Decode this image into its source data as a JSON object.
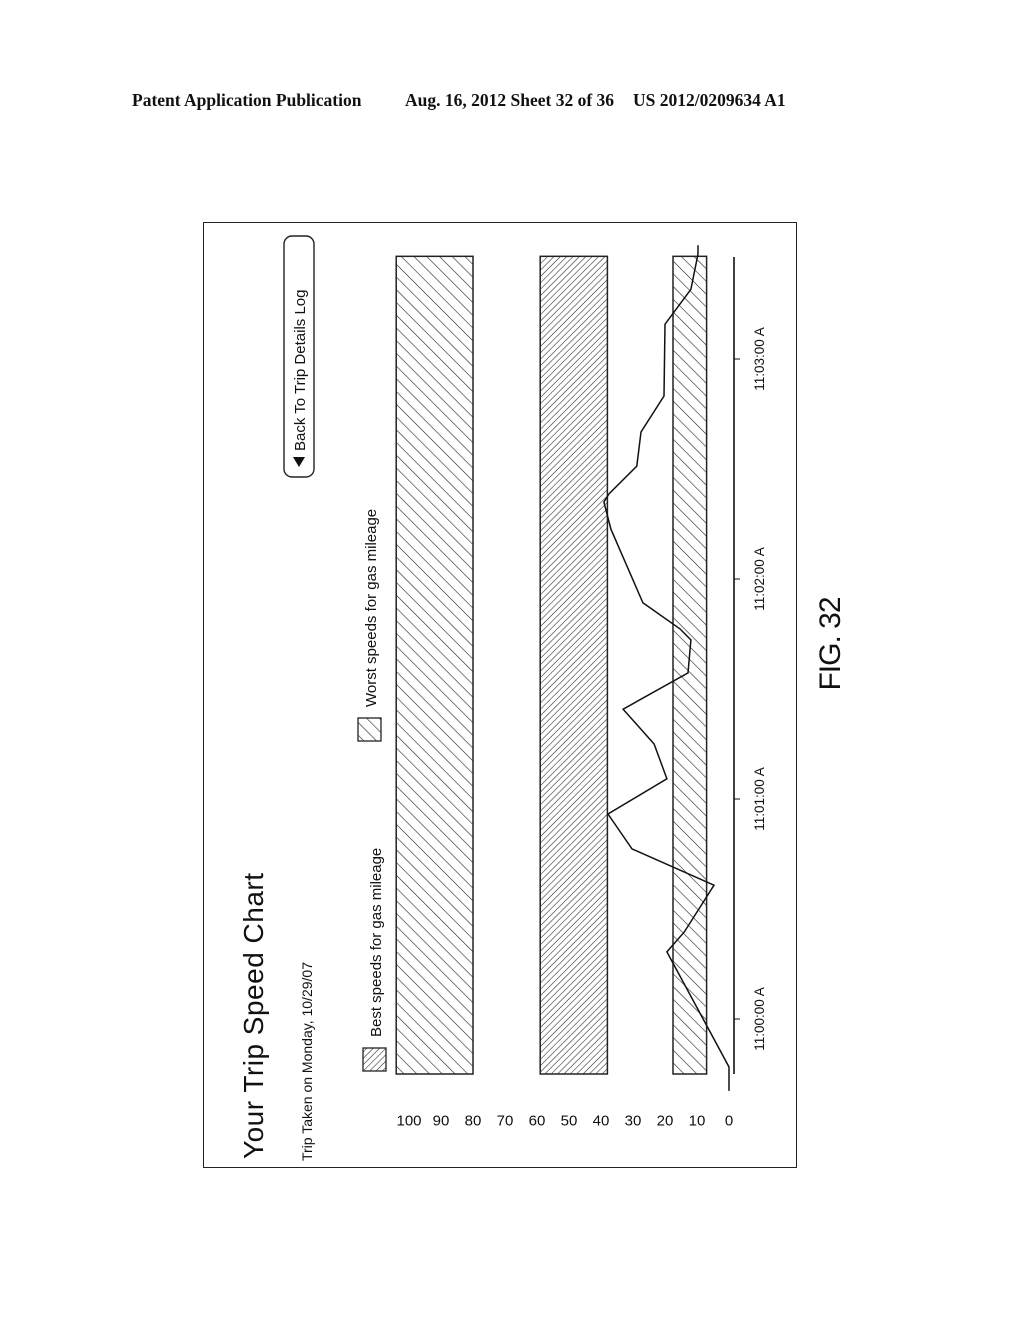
{
  "header": {
    "left": "Patent Application Publication",
    "middle": "Aug. 16, 2012  Sheet 32 of 36",
    "right": "US 2012/0209634 A1"
  },
  "figure_label": "FIG. 32",
  "screen": {
    "title": "Your Trip Speed Chart",
    "subtitle": "Trip Taken on Monday, 10/29/07",
    "back_button": {
      "label": "Back To Trip Details Log",
      "icon": "triangle-left-icon"
    }
  },
  "chart_data": {
    "type": "line",
    "title": "Your Trip Speed Chart",
    "subtitle": "Trip Taken on Monday, 10/29/07",
    "xlabel": "",
    "ylabel": "",
    "orientation": "rotated -90 degrees on page",
    "ylim": [
      0,
      100
    ],
    "yticks": [
      "100",
      "90",
      "80",
      "70",
      "60",
      "50",
      "40",
      "30",
      "20",
      "10",
      "0"
    ],
    "ytick_values": [
      100,
      90,
      80,
      70,
      60,
      50,
      40,
      30,
      20,
      10,
      0
    ],
    "xticks": [
      "11:00:00 A",
      "11:01:00 A",
      "11:02:00 A",
      "11:03:00 A"
    ],
    "xtick_seconds": [
      0,
      60,
      120,
      180
    ],
    "xlim_seconds": [
      -20,
      210
    ],
    "grid": false,
    "legend": [
      {
        "name": "Best speeds for gas mileage",
        "pattern": "dense-hatch"
      },
      {
        "name": "Worst speeds for gas mileage",
        "pattern": "sparse-hatch"
      }
    ],
    "legend_position": "top",
    "bands": [
      {
        "name": "Worst speeds for gas mileage",
        "low": 80,
        "high": 104,
        "pattern": "sparse-hatch"
      },
      {
        "name": "Best speeds for gas mileage",
        "low": 38,
        "high": 59,
        "pattern": "dense-hatch"
      },
      {
        "name": "Worst speeds for gas mileage",
        "low": 7,
        "high": 17.5,
        "pattern": "sparse-hatch"
      }
    ],
    "band_time_range_seconds": [
      -15,
      208
    ],
    "series": [
      {
        "name": "Trip speed",
        "t_seconds": [
          -19.6,
          -13.1,
          -8.2,
          18.3,
          23.7,
          36.5,
          46.4,
          54,
          55.9,
          65.5,
          75,
          84.5,
          94.4,
          103.4,
          106.4,
          113.5,
          127.4,
          133.6,
          141,
          143.2,
          150.8,
          160.1,
          169.9,
          189.5,
          199,
          208.6,
          211
        ],
        "speed": [
          0,
          0,
          3,
          19.4,
          14,
          4.7,
          30.3,
          36.3,
          37.8,
          19.4,
          23.4,
          33.1,
          12.8,
          11.9,
          15.3,
          26.9,
          33.8,
          36.9,
          39.1,
          37.5,
          28.8,
          27.5,
          20.3,
          20,
          11.9,
          9.7,
          9.7
        ]
      }
    ]
  }
}
